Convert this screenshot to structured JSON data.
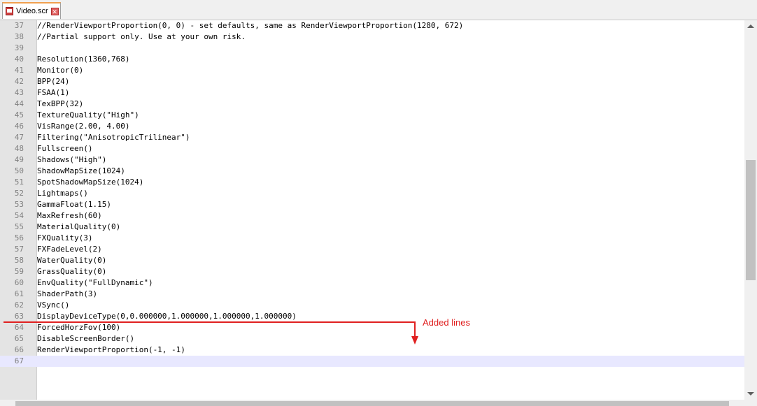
{
  "tab": {
    "filename": "Video.scr"
  },
  "editor": {
    "lines": [
      {
        "num": "37",
        "text": "//RenderViewportProportion(0, 0) - set defaults, same as RenderViewportProportion(1280, 672)"
      },
      {
        "num": "38",
        "text": "//Partial support only. Use at your own risk."
      },
      {
        "num": "39",
        "text": ""
      },
      {
        "num": "40",
        "text": "Resolution(1360,768)"
      },
      {
        "num": "41",
        "text": "Monitor(0)"
      },
      {
        "num": "42",
        "text": "BPP(24)"
      },
      {
        "num": "43",
        "text": "FSAA(1)"
      },
      {
        "num": "44",
        "text": "TexBPP(32)"
      },
      {
        "num": "45",
        "text": "TextureQuality(\"High\")"
      },
      {
        "num": "46",
        "text": "VisRange(2.00, 4.00)"
      },
      {
        "num": "47",
        "text": "Filtering(\"AnisotropicTrilinear\")"
      },
      {
        "num": "48",
        "text": "Fullscreen()"
      },
      {
        "num": "49",
        "text": "Shadows(\"High\")"
      },
      {
        "num": "50",
        "text": "ShadowMapSize(1024)"
      },
      {
        "num": "51",
        "text": "SpotShadowMapSize(1024)"
      },
      {
        "num": "52",
        "text": "Lightmaps()"
      },
      {
        "num": "53",
        "text": "GammaFloat(1.15)"
      },
      {
        "num": "54",
        "text": "MaxRefresh(60)"
      },
      {
        "num": "55",
        "text": "MaterialQuality(0)"
      },
      {
        "num": "56",
        "text": "FXQuality(3)"
      },
      {
        "num": "57",
        "text": "FXFadeLevel(2)"
      },
      {
        "num": "58",
        "text": "WaterQuality(0)"
      },
      {
        "num": "59",
        "text": "GrassQuality(0)"
      },
      {
        "num": "60",
        "text": "EnvQuality(\"FullDynamic\")"
      },
      {
        "num": "61",
        "text": "ShaderPath(3)"
      },
      {
        "num": "62",
        "text": "VSync()"
      },
      {
        "num": "63",
        "text": "DisplayDeviceType(0,0.000000,1.000000,1.000000,1.000000)"
      },
      {
        "num": "64",
        "text": "ForcedHorzFov(100)"
      },
      {
        "num": "65",
        "text": "DisableScreenBorder()"
      },
      {
        "num": "66",
        "text": "RenderViewportProportion(-1, -1)"
      },
      {
        "num": "67",
        "text": ""
      }
    ],
    "current_line": "67"
  },
  "annotation": {
    "label": "Added lines",
    "color": "#e02020"
  }
}
